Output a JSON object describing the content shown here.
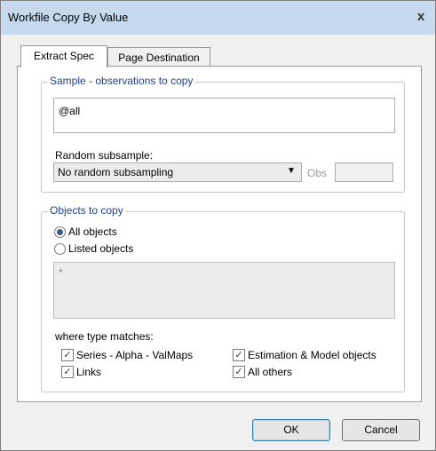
{
  "window": {
    "title": "Workfile Copy By Value",
    "close_label": "x"
  },
  "tabs": [
    {
      "label": "Extract Spec",
      "active": true
    },
    {
      "label": "Page Destination",
      "active": false
    }
  ],
  "sample_group": {
    "title": "Sample - observations to copy",
    "sample_value": "@all",
    "random_label": "Random subsample:",
    "random_selected": "No random subsampling",
    "obs_label": "Obs",
    "obs_value": ""
  },
  "objects_group": {
    "title": "Objects to copy",
    "radio_all": "All objects",
    "radio_listed": "Listed objects",
    "listed_value": "*",
    "type_label": "where type matches:",
    "checks": {
      "series": "Series - Alpha - ValMaps",
      "estimation": "Estimation & Model objects",
      "links": "Links",
      "others": "All others"
    }
  },
  "buttons": {
    "ok": "OK",
    "cancel": "Cancel"
  },
  "colors": {
    "accent": "#1c3f8c",
    "titlebar": "#c6d9ee"
  }
}
